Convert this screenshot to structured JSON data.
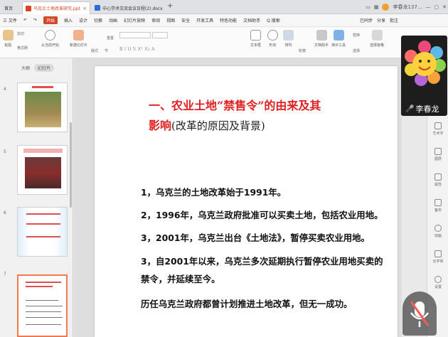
{
  "tabs": {
    "home": "首页",
    "active": "乌克兰土地改革研究.ppt",
    "doc": "中心学术交流会议日程(2).docx",
    "new": "+"
  },
  "titlebar": {
    "user": "李春龙137..."
  },
  "menu": {
    "items": [
      "三 文件",
      "开始",
      "插入",
      "设计",
      "切换",
      "动画",
      "幻灯片放映",
      "审阅",
      "视图",
      "安全",
      "开发工具",
      "特色功能",
      "文档助手",
      "Q 搜索"
    ],
    "right": [
      "已同步",
      "分享",
      "批注"
    ]
  },
  "ribbon": {
    "paste": "粘贴",
    "cut": "剪切",
    "format_painter": "格式刷",
    "from_current": "从当前开始",
    "new_slide": "新建幻灯片",
    "layout": "版式",
    "section": "节",
    "reset": "重置",
    "textbox": "文本框",
    "shape": "形状",
    "arrange": "排列",
    "outline": "轮廓",
    "text_tools": "文档助手",
    "presenter": "演示工具",
    "replace": "替换",
    "select": "选择",
    "select_pane": "选择窗格",
    "draw_tool": "绘图工具"
  },
  "panel": {
    "outline": "大纲",
    "slides": "幻灯片",
    "numbers": [
      "4",
      "5",
      "6",
      "7"
    ]
  },
  "slide": {
    "title_line1": "一、农业土地“禁售令”的由来及其",
    "title_line2_red": "影响",
    "title_line2_black": "(改革的原因及背景)",
    "lines": [
      "1，乌克兰的土地改革始于1991年。",
      "2，1996年，乌克兰政府批准可以买卖土地，包括农业用地。",
      "3，2001年，乌克兰出台《土地法》，暂停买卖农业用地。",
      "3，自2001年以来，乌克兰多次延期执行暂停农业用地买卖的",
      "禁令，并延续至今。",
      "历任乌克兰政府都曾计划推进土地改革，但无一成功。"
    ]
  },
  "right_panel": [
    "艺术字",
    "图层",
    "属性",
    "备份",
    "动画",
    "云字体",
    "设置"
  ],
  "camera": {
    "name": "李春龙"
  },
  "colors": {
    "accent": "#d24726",
    "title_red": "#e02020"
  }
}
